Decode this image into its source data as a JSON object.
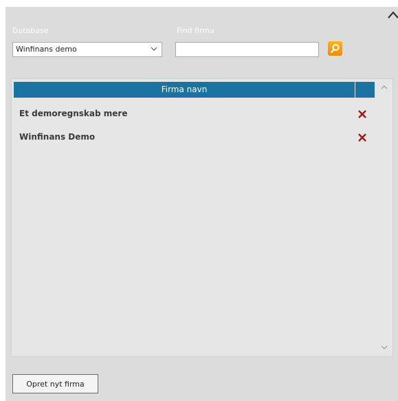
{
  "filters": {
    "database_label": "Database",
    "database_value": "Winfinans demo",
    "find_label": "Find firma",
    "find_value": "",
    "find_placeholder": ""
  },
  "table": {
    "header": "Firma navn",
    "rows": [
      {
        "name": "Et demoregnskab mere"
      },
      {
        "name": "Winfinans Demo"
      }
    ]
  },
  "footer": {
    "create_label": "Opret nyt firma"
  },
  "colors": {
    "header_bg": "#1b73a1",
    "delete_icon": "#a31515",
    "search_button": "#f28a00",
    "panel_bg": "#dcdcdc"
  },
  "icons": {
    "close": "close-icon",
    "search": "search-icon",
    "delete": "delete-x-icon",
    "dropdown": "chevron-down-icon"
  }
}
